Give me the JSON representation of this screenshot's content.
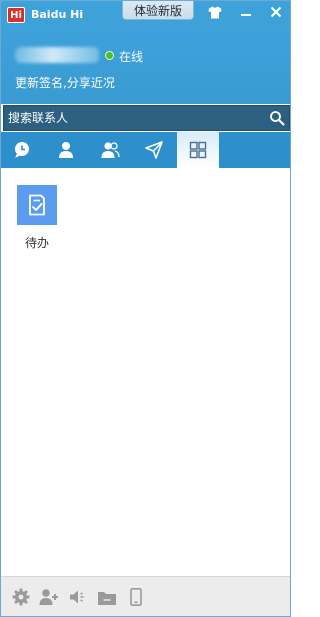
{
  "window": {
    "app_name": "Baidu Hi",
    "logo_text": "Hi",
    "beta_button": "体验新版"
  },
  "user": {
    "name": "",
    "status": "在线",
    "signature_prompt": "更新签名,分享近况"
  },
  "search": {
    "placeholder": "搜索联系人"
  },
  "tabs": [
    {
      "id": "chats",
      "icon": "chat-bubble-icon"
    },
    {
      "id": "contacts",
      "icon": "person-icon"
    },
    {
      "id": "groups",
      "icon": "group-icon"
    },
    {
      "id": "discover",
      "icon": "paper-plane-icon"
    },
    {
      "id": "apps",
      "icon": "apps-grid-icon",
      "active": true
    }
  ],
  "apps": [
    {
      "label": "待办",
      "icon": "todo-check-icon"
    }
  ],
  "bottom_toolbar": [
    {
      "id": "settings",
      "icon": "gear-icon"
    },
    {
      "id": "add-contact",
      "icon": "add-person-icon"
    },
    {
      "id": "sound",
      "icon": "speaker-icon"
    },
    {
      "id": "files",
      "icon": "folder-icon"
    },
    {
      "id": "mobile",
      "icon": "phone-icon"
    }
  ],
  "colors": {
    "header_blue": "#3ea3da",
    "tab_bar_blue": "#2e8fcd",
    "search_bg": "#2c5f80",
    "online_green": "#4cc21f",
    "app_tile_blue": "#5b9bf0"
  }
}
